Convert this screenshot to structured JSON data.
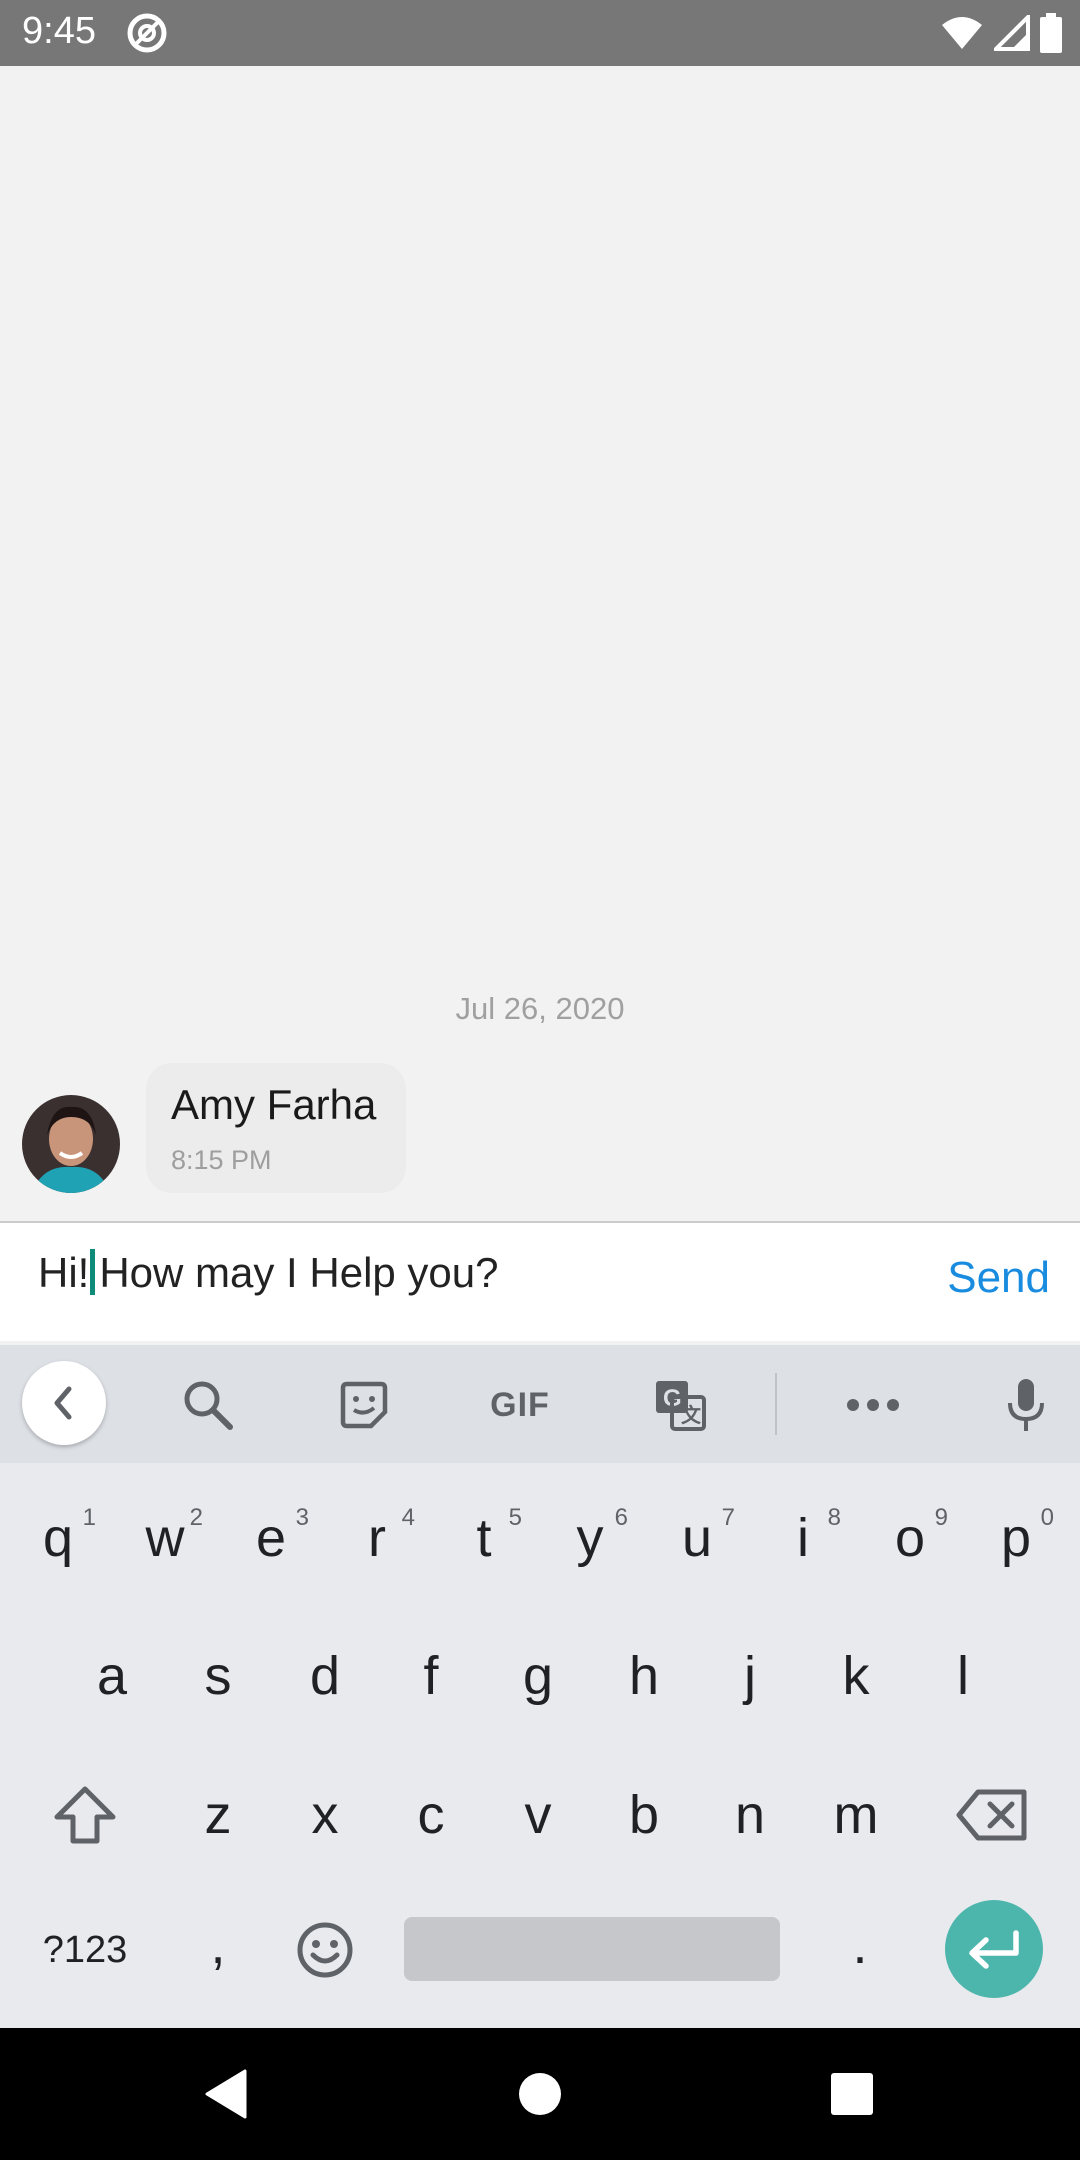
{
  "status_bar": {
    "time": "9:45"
  },
  "chat": {
    "date_separator": "Jul 26, 2020",
    "message": {
      "sender": "Amy Farha",
      "time": "8:15 PM"
    }
  },
  "composer": {
    "text_before_cursor": "Hi!",
    "text_after_cursor": "How may I Help you?",
    "send_label": "Send"
  },
  "keyboard": {
    "toolbar": {
      "gif_label": "GIF"
    },
    "row1": [
      {
        "key": "q",
        "hint": "1"
      },
      {
        "key": "w",
        "hint": "2"
      },
      {
        "key": "e",
        "hint": "3"
      },
      {
        "key": "r",
        "hint": "4"
      },
      {
        "key": "t",
        "hint": "5"
      },
      {
        "key": "y",
        "hint": "6"
      },
      {
        "key": "u",
        "hint": "7"
      },
      {
        "key": "i",
        "hint": "8"
      },
      {
        "key": "o",
        "hint": "9"
      },
      {
        "key": "p",
        "hint": "0"
      }
    ],
    "row2": [
      "a",
      "s",
      "d",
      "f",
      "g",
      "h",
      "j",
      "k",
      "l"
    ],
    "row3": [
      "z",
      "x",
      "c",
      "v",
      "b",
      "n",
      "m"
    ],
    "row4": {
      "symbols": "?123",
      "comma": ",",
      "period": "."
    }
  },
  "colors": {
    "accent": "#1a8ce0",
    "enter": "#4db6ac",
    "status_bar": "#777777"
  }
}
